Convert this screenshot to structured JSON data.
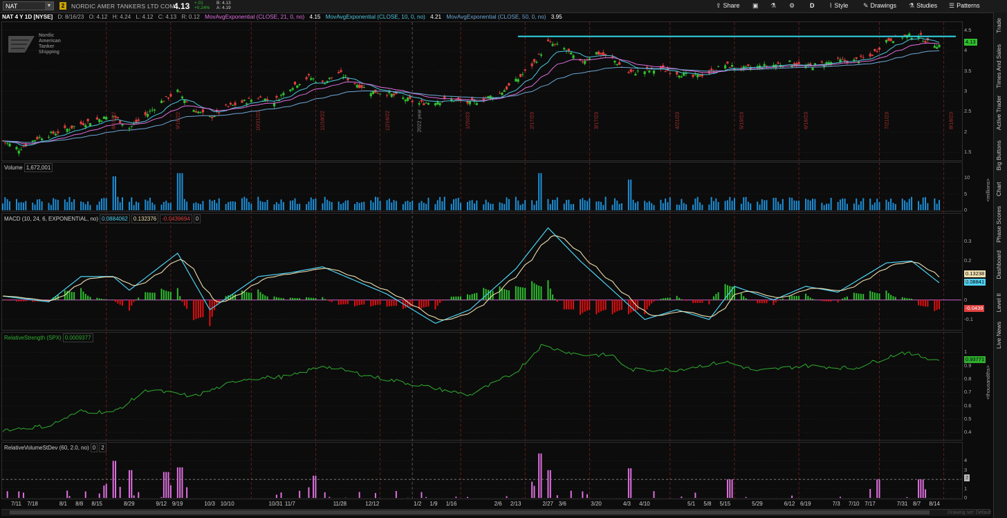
{
  "header": {
    "symbol": "NAT",
    "badge": "2",
    "company": "NORDIC AMER TANKERS LTD COM",
    "last": "4.13",
    "change": "+.01",
    "change_pct": "+0.24%",
    "bid": "B: 4.13",
    "ask": "A: 4.19",
    "buttons": {
      "share": "Share",
      "style": "Style",
      "drawings": "Drawings",
      "studies": "Studies",
      "patterns": "Patterns",
      "period": "D"
    }
  },
  "info": {
    "chart_label": "NAT 4 Y 1D [NYSE]",
    "date": "D: 8/16/23",
    "open": "O: 4.12",
    "high": "H: 4.24",
    "low": "L: 4.12",
    "close": "C: 4.13",
    "range": "R: 0.12",
    "ema21_label": "MovAvgExponential (CLOSE, 21, 0, no)",
    "ema21_value": "4.15",
    "ema10_label": "MovAvgExponential (CLOSE, 10, 0, no)",
    "ema10_value": "4.21",
    "ema50_label": "MovAvgExponential (CLOSE, 50, 0, no)",
    "ema50_value": "3.95"
  },
  "logo": {
    "line1": "Nordic",
    "line2": "American",
    "line3": "Tanker",
    "line4": "Shipping"
  },
  "panels": {
    "volume": {
      "label": "Volume",
      "value": "1,672,001",
      "ticks": [
        "10",
        "5",
        "0"
      ],
      "unit": "<millions>"
    },
    "macd": {
      "label": "MACD (10, 24, 6, EXPONENTIAL, no)",
      "v1": "0.0884062",
      "v2": "0.132376",
      "v3": "-0.0439694",
      "v4": "0",
      "ticks": [
        "0.3",
        "0.2",
        "0.1",
        "0",
        "-0.1"
      ],
      "tag_avg": "0.13238",
      "tag_value": "0.08841",
      "tag_diff": "-0.0439"
    },
    "rs": {
      "label": "RelativeStrength (SPX)",
      "value": "0.0009377",
      "ticks": [
        "1",
        "0.9",
        "0.8",
        "0.7",
        "0.6",
        "0.5",
        "0.4"
      ],
      "tag": "0.93771",
      "unit": "<thousandths>"
    },
    "rvsd": {
      "label": "RelativeVolumeStDev (60, 2.0, no)",
      "v1": "0",
      "v2": "2",
      "ticks": [
        "4",
        "3",
        "2",
        "1",
        "0"
      ],
      "tag": "2"
    }
  },
  "price_axis": {
    "ticks": [
      "4.5",
      "4",
      "3.5",
      "3",
      "2.5",
      "2",
      "1.5"
    ],
    "last_tag": "4.13"
  },
  "x_axis": [
    "7/11",
    "7/18",
    "8/1",
    "8/8",
    "8/15",
    "8/29",
    "9/12",
    "9/19",
    "10/3",
    "10/10",
    "10/31",
    "11/7",
    "11/28",
    "12/12",
    "1/2",
    "1/9",
    "1/16",
    "2/6",
    "2/13",
    "2/27",
    "3/6",
    "3/20",
    "4/3",
    "4/10",
    "5/1",
    "5/8",
    "5/15",
    "5/29",
    "6/12",
    "6/19",
    "7/3",
    "7/10",
    "7/17",
    "7/31",
    "8/7",
    "8/14"
  ],
  "vlines": [
    "8/19/22",
    "9/16/22",
    "10/21/22",
    "11/18/22",
    "12/16/22",
    "2022 year",
    "1/20/23",
    "2/17/23",
    "3/17/23",
    "4/21/23",
    "5/19/23",
    "6/16/23",
    "7/21/23",
    "8/18/23"
  ],
  "right_tabs": [
    "Trade",
    "Times And Sales",
    "Active Trader",
    "Big Buttons",
    "Chart",
    "Phase Scores",
    "Dashboard",
    "Level II",
    "Live News"
  ],
  "watermark": "Drawing set: Default",
  "colors": {
    "up": "#2fbf2f",
    "down": "#e04040",
    "ema10": "#4fc7e0",
    "ema21": "#e070e0",
    "ema50": "#6fa8d8",
    "resistance": "#2fd9e9",
    "volume": "#1e8fd8",
    "macd_value": "#4fd3f3",
    "macd_avg": "#f0e0b0",
    "rs_line": "#2fae2f",
    "rvsd": "#e070e0"
  },
  "chart_data": [
    {
      "type": "candlestick",
      "title": "NAT 4 Y 1D [NYSE]",
      "x_range": [
        "7/5/22",
        "8/16/23"
      ],
      "ylim": [
        1.3,
        4.7
      ],
      "close_path": [
        [
          "7/5/22",
          1.78
        ],
        [
          "7/12/22",
          1.58
        ],
        [
          "7/20/22",
          1.85
        ],
        [
          "8/1/22",
          2.05
        ],
        [
          "8/8/22",
          2.2
        ],
        [
          "8/15/22",
          2.3
        ],
        [
          "8/22/22",
          2.4
        ],
        [
          "8/29/22",
          2.1
        ],
        [
          "9/6/22",
          2.45
        ],
        [
          "9/12/22",
          2.75
        ],
        [
          "9/19/22",
          3.0
        ],
        [
          "9/26/22",
          2.55
        ],
        [
          "10/3/22",
          2.35
        ],
        [
          "10/10/22",
          2.6
        ],
        [
          "10/24/22",
          2.85
        ],
        [
          "10/31/22",
          2.75
        ],
        [
          "11/7/22",
          3.1
        ],
        [
          "11/15/22",
          3.35
        ],
        [
          "11/21/22",
          3.2
        ],
        [
          "11/28/22",
          3.45
        ],
        [
          "12/5/22",
          3.2
        ],
        [
          "12/12/22",
          3.0
        ],
        [
          "12/19/22",
          2.95
        ],
        [
          "1/2/23",
          2.7
        ],
        [
          "1/9/23",
          2.75
        ],
        [
          "1/16/23",
          2.8
        ],
        [
          "1/24/23",
          2.7
        ],
        [
          "2/6/23",
          2.95
        ],
        [
          "2/13/23",
          3.25
        ],
        [
          "2/21/23",
          3.7
        ],
        [
          "2/27/23",
          4.2
        ],
        [
          "3/6/23",
          4.05
        ],
        [
          "3/13/23",
          3.7
        ],
        [
          "3/20/23",
          3.95
        ],
        [
          "3/27/23",
          3.8
        ],
        [
          "4/3/23",
          3.45
        ],
        [
          "4/10/23",
          3.5
        ],
        [
          "4/17/23",
          3.55
        ],
        [
          "5/1/23",
          3.35
        ],
        [
          "5/8/23",
          3.45
        ],
        [
          "5/15/23",
          3.65
        ],
        [
          "5/22/23",
          3.55
        ],
        [
          "5/29/23",
          3.6
        ],
        [
          "6/12/23",
          3.7
        ],
        [
          "6/19/23",
          3.6
        ],
        [
          "7/3/23",
          3.75
        ],
        [
          "7/10/23",
          3.75
        ],
        [
          "7/17/23",
          3.85
        ],
        [
          "7/24/23",
          4.25
        ],
        [
          "7/31/23",
          4.35
        ],
        [
          "8/7/23",
          4.38
        ],
        [
          "8/11/23",
          4.2
        ],
        [
          "8/16/23",
          4.13
        ]
      ],
      "resistance_level": 4.35,
      "series": [
        {
          "name": "MovAvgExponential (CLOSE, 10, 0, no)",
          "last": 4.21
        },
        {
          "name": "MovAvgExponential (CLOSE, 21, 0, no)",
          "last": 4.15
        },
        {
          "name": "MovAvgExponential (CLOSE, 50, 0, no)",
          "last": 3.95
        }
      ]
    },
    {
      "type": "bar",
      "title": "Volume",
      "ylabel": "<millions>",
      "ylim": [
        0,
        12
      ],
      "last": 1.672001,
      "peaks": [
        [
          "8/22/22",
          10.5
        ],
        [
          "9/20/22",
          11.5
        ],
        [
          "2/24/23",
          11.5
        ],
        [
          "4/3/23",
          9.5
        ]
      ]
    },
    {
      "type": "line",
      "title": "MACD (10, 24, 6, EXPONENTIAL, no)",
      "ylim": [
        -0.15,
        0.4
      ],
      "series": [
        {
          "name": "Value",
          "last": 0.0884062
        },
        {
          "name": "Avg",
          "last": 0.132376
        },
        {
          "name": "Diff",
          "last": -0.0439694
        }
      ],
      "value_path": [
        [
          "7/5/22",
          0.02
        ],
        [
          "7/25/22",
          -0.01
        ],
        [
          "8/8/22",
          0.12
        ],
        [
          "8/22/22",
          0.12
        ],
        [
          "8/29/22",
          0.05
        ],
        [
          "9/19/22",
          0.24
        ],
        [
          "10/3/22",
          -0.05
        ],
        [
          "10/24/22",
          0.12
        ],
        [
          "11/7/22",
          0.14
        ],
        [
          "11/21/22",
          0.17
        ],
        [
          "12/19/22",
          0.03
        ],
        [
          "1/9/23",
          -0.12
        ],
        [
          "1/24/23",
          -0.05
        ],
        [
          "2/13/23",
          0.16
        ],
        [
          "2/27/23",
          0.37
        ],
        [
          "3/13/23",
          0.2
        ],
        [
          "4/10/23",
          -0.1
        ],
        [
          "4/24/23",
          -0.05
        ],
        [
          "5/8/23",
          -0.1
        ],
        [
          "5/19/23",
          0.07
        ],
        [
          "6/5/23",
          0.0
        ],
        [
          "6/19/23",
          0.07
        ],
        [
          "7/3/23",
          0.04
        ],
        [
          "7/24/23",
          0.19
        ],
        [
          "8/4/23",
          0.2
        ],
        [
          "8/16/23",
          0.088
        ]
      ]
    },
    {
      "type": "line",
      "title": "RelativeStrength (SPX)",
      "ylabel": "<thousandths>",
      "ylim": [
        0.35,
        1.08
      ],
      "last": 0.93771,
      "path": [
        [
          "7/5/22",
          0.42
        ],
        [
          "7/25/22",
          0.45
        ],
        [
          "8/8/22",
          0.56
        ],
        [
          "8/22/22",
          0.55
        ],
        [
          "9/6/22",
          0.72
        ],
        [
          "9/26/22",
          0.67
        ],
        [
          "10/17/22",
          0.8
        ],
        [
          "11/7/22",
          0.82
        ],
        [
          "11/21/22",
          0.9
        ],
        [
          "12/12/22",
          0.82
        ],
        [
          "1/9/23",
          0.73
        ],
        [
          "1/24/23",
          0.68
        ],
        [
          "2/13/23",
          0.85
        ],
        [
          "2/24/23",
          1.05
        ],
        [
          "3/13/23",
          0.98
        ],
        [
          "3/27/23",
          0.98
        ],
        [
          "4/3/23",
          0.87
        ],
        [
          "4/24/23",
          0.87
        ],
        [
          "5/15/23",
          0.93
        ],
        [
          "5/29/23",
          0.86
        ],
        [
          "6/19/23",
          0.9
        ],
        [
          "7/10/23",
          0.88
        ],
        [
          "7/31/23",
          1.0
        ],
        [
          "8/16/23",
          0.94
        ]
      ]
    },
    {
      "type": "bar",
      "title": "RelativeVolumeStDev (60, 2.0, no)",
      "ylim": [
        0,
        5
      ],
      "threshold": 2,
      "peaks": [
        [
          "8/22/22",
          4.0
        ],
        [
          "8/29/22",
          3.0
        ],
        [
          "9/14/22",
          2.8
        ],
        [
          "9/20/22",
          3.3
        ],
        [
          "11/18/22",
          2.4
        ],
        [
          "2/24/23",
          4.8
        ],
        [
          "2/27/23",
          3.0
        ],
        [
          "4/3/23",
          3.2
        ],
        [
          "5/17/23",
          2.0
        ],
        [
          "7/21/23",
          2.0
        ],
        [
          "8/8/23",
          2.0
        ]
      ]
    }
  ]
}
